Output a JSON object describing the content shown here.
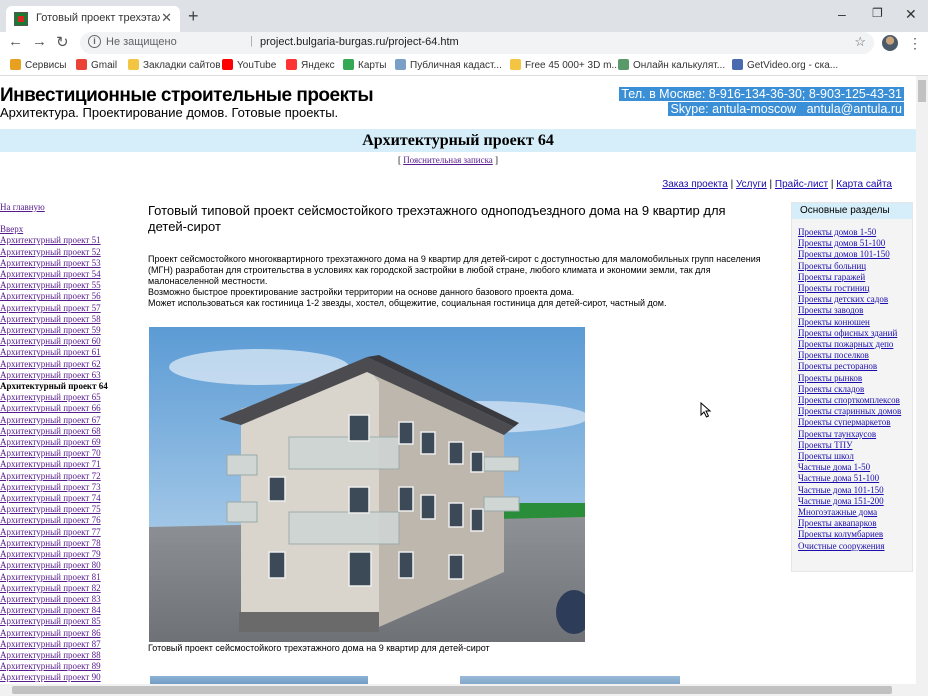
{
  "browser": {
    "tab_title": "Готовый проект трехэтажного д",
    "security": "Не защищено",
    "url": "project.bulgaria-burgas.ru/project-64.htm",
    "bookmarks": [
      {
        "label": "Сервисы",
        "color": "#e8a020"
      },
      {
        "label": "Gmail",
        "color": "#ea4335"
      },
      {
        "label": "Закладки сайтов",
        "color": "#f4c542"
      },
      {
        "label": "YouTube",
        "color": "#ff0000"
      },
      {
        "label": "Яндекс",
        "color": "#ff3333"
      },
      {
        "label": "Карты",
        "color": "#34a853"
      },
      {
        "label": "Публичная кадаст...",
        "color": "#7aa0c8"
      },
      {
        "label": "Free 45 000+ 3D m...",
        "color": "#f4c542"
      },
      {
        "label": "Онлайн калькулят...",
        "color": "#5a9a6a"
      },
      {
        "label": "GetVideo.org - ска...",
        "color": "#4a6ab0"
      }
    ]
  },
  "header": {
    "title": "Инвестиционные строительные проекты",
    "subtitle": "Архитектура. Проектирование домов. Готовые проекты.",
    "phone_line": "Тел. в Москве: 8-916-134-36-30; 8-903-125-43-31",
    "skype_line": "Skype: antula-moscow   antula@antula.ru"
  },
  "project": {
    "title": "Архитектурный проект 64",
    "note_open": "[ ",
    "note_link": "Пояснительная записка",
    "note_close": " ]"
  },
  "toplinks": [
    {
      "label": "Заказ проекта"
    },
    {
      "label": "Услуги"
    },
    {
      "label": "Прайс-лист"
    },
    {
      "label": "Карта сайта"
    }
  ],
  "toplinks_sep": " | ",
  "leftnav": {
    "home": "На главную",
    "up": "Вверх",
    "items": [
      "Архитектурный проект 51",
      "Архитектурный проект 52",
      "Архитектурный проект 53",
      "Архитектурный проект 54",
      "Архитектурный проект 55",
      "Архитектурный проект 56",
      "Архитектурный проект 57",
      "Архитектурный проект 58",
      "Архитектурный проект 59",
      "Архитектурный проект 60",
      "Архитектурный проект 61",
      "Архитектурный проект 62",
      "Архитектурный проект 63",
      "Архитектурный проект 64",
      "Архитектурный проект 65",
      "Архитектурный проект 66",
      "Архитектурный проект 67",
      "Архитектурный проект 68",
      "Архитектурный проект 69",
      "Архитектурный проект 70",
      "Архитектурный проект 71",
      "Архитектурный проект 72",
      "Архитектурный проект 73",
      "Архитектурный проект 74",
      "Архитектурный проект 75",
      "Архитектурный проект 76",
      "Архитектурный проект 77",
      "Архитектурный проект 78",
      "Архитектурный проект 79",
      "Архитектурный проект 80",
      "Архитектурный проект 81",
      "Архитектурный проект 82",
      "Архитектурный проект 83",
      "Архитектурный проект 84",
      "Архитектурный проект 85",
      "Архитектурный проект 86",
      "Архитектурный проект 87",
      "Архитектурный проект 88",
      "Архитектурный проект 89",
      "Архитектурный проект 90"
    ],
    "current": "Архитектурный проект 64"
  },
  "main": {
    "heading": "Готовый типовой проект сейсмостойкого трехэтажного однoподъездного дома на 9 квартир для детей-сирот",
    "paragraph1": "Проект сейсмостойкого многоквартирного трехэтажного дома на 9 квартир для детей-сирот с доступностью для маломобильных групп населения (МГН) разработан для строительства в условиях как городской застройки в любой стране, любого климата и экономии земли, так для малонаселенной местности.",
    "paragraph2": "Возможно быстрое проектирование застройки территории на основе данного базового проекта дома.",
    "paragraph3": "Может использоваться как гостиница 1-2 звезды, хостел, общежитие, социальная гостиница для детей-сирот, частный дом.",
    "caption": "Готовый проект сейсмостойкого трехэтажного дома на 9 квартир для детей-сирот"
  },
  "sidebar": {
    "title": "Основные разделы",
    "items": [
      "Проекты домов 1-50",
      "Проекты домов 51-100",
      "Проекты домов 101-150",
      "Проекты больниц",
      "Проекты гаражей",
      "Проекты гостиниц",
      "Проекты детских садов",
      "Проекты заводов",
      "Проекты конюшен",
      "Проекты офисных зданий",
      "Проекты пожарных депо",
      "Проекты поселков",
      "Проекты ресторанов",
      "Проекты рынков",
      "Проекты складов",
      "Проекты спорткомплексов",
      "Проекты старинных домов",
      "Проекты супермаркетов",
      "Проекты таунхаусов",
      "Проекты ТПУ",
      "Проекты школ",
      "Частные дома 1-50",
      "Частные дома 51-100",
      "Частные дома 101-150",
      "Частные дома 151-200",
      "Многоэтажные дома",
      "Проекты аквапарков",
      "Проекты колумбариев",
      "Очистные сооружения"
    ]
  }
}
